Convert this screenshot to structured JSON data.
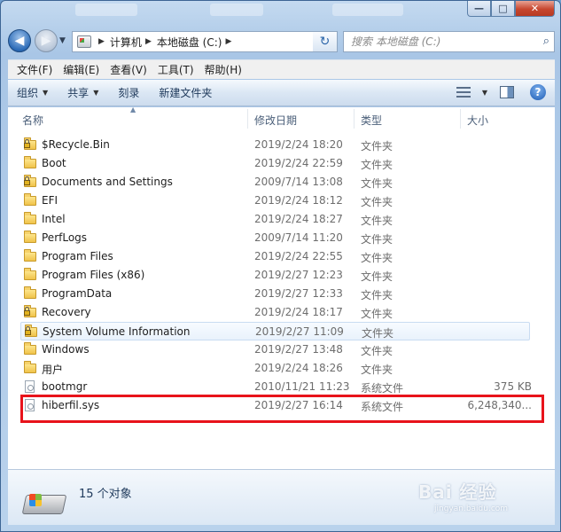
{
  "window": {
    "caption_buttons": {
      "minimize": "—",
      "maximize": "□",
      "close": "✕"
    }
  },
  "nav": {
    "back_glyph": "◀",
    "forward_glyph": "▶",
    "breadcrumb": [
      "计算机",
      "本地磁盘 (C:)"
    ],
    "refresh_glyph": "↻",
    "search_placeholder": "搜索 本地磁盘 (C:)"
  },
  "menu": [
    "文件(F)",
    "编辑(E)",
    "查看(V)",
    "工具(T)",
    "帮助(H)"
  ],
  "toolbar": {
    "organize": "组织",
    "share": "共享",
    "burn": "刻录",
    "new_folder": "新建文件夹",
    "help": "?"
  },
  "columns": {
    "name": "名称",
    "date": "修改日期",
    "type": "类型",
    "size": "大小"
  },
  "files": [
    {
      "name": "$Recycle.Bin",
      "date": "2019/2/24 18:20",
      "type": "文件夹",
      "size": "",
      "icon": "folder-locked-icon"
    },
    {
      "name": "Boot",
      "date": "2019/2/24 22:59",
      "type": "文件夹",
      "size": "",
      "icon": "folder-icon"
    },
    {
      "name": "Documents and Settings",
      "date": "2009/7/14 13:08",
      "type": "文件夹",
      "size": "",
      "icon": "folder-locked-icon"
    },
    {
      "name": "EFI",
      "date": "2019/2/24 18:12",
      "type": "文件夹",
      "size": "",
      "icon": "folder-icon"
    },
    {
      "name": "Intel",
      "date": "2019/2/24 18:27",
      "type": "文件夹",
      "size": "",
      "icon": "folder-icon"
    },
    {
      "name": "PerfLogs",
      "date": "2009/7/14 11:20",
      "type": "文件夹",
      "size": "",
      "icon": "folder-icon"
    },
    {
      "name": "Program Files",
      "date": "2019/2/24 22:55",
      "type": "文件夹",
      "size": "",
      "icon": "folder-icon"
    },
    {
      "name": "Program Files (x86)",
      "date": "2019/2/27 12:23",
      "type": "文件夹",
      "size": "",
      "icon": "folder-icon"
    },
    {
      "name": "ProgramData",
      "date": "2019/2/27 12:33",
      "type": "文件夹",
      "size": "",
      "icon": "folder-icon"
    },
    {
      "name": "Recovery",
      "date": "2019/2/24 18:17",
      "type": "文件夹",
      "size": "",
      "icon": "folder-locked-icon"
    },
    {
      "name": "System Volume Information",
      "date": "2019/2/27 11:09",
      "type": "文件夹",
      "size": "",
      "icon": "folder-locked-icon",
      "selected": true
    },
    {
      "name": "Windows",
      "date": "2019/2/27 13:48",
      "type": "文件夹",
      "size": "",
      "icon": "folder-icon"
    },
    {
      "name": "用户",
      "date": "2019/2/24 18:26",
      "type": "文件夹",
      "size": "",
      "icon": "folder-icon"
    },
    {
      "name": "bootmgr",
      "date": "2010/11/21 11:23",
      "type": "系统文件",
      "size": "375 KB",
      "icon": "system-file-icon"
    },
    {
      "name": "hiberfil.sys",
      "date": "2019/2/27 16:14",
      "type": "系统文件",
      "size": "6,248,340...",
      "icon": "system-file-icon",
      "highlighted": true
    }
  ],
  "details": {
    "item_count": "15 个对象"
  },
  "watermark": {
    "main": "Bai 经验",
    "sub": "jingyan.baidu.com"
  },
  "colors": {
    "highlight_border": "#e8131b",
    "selection": "#e9f2fc"
  }
}
